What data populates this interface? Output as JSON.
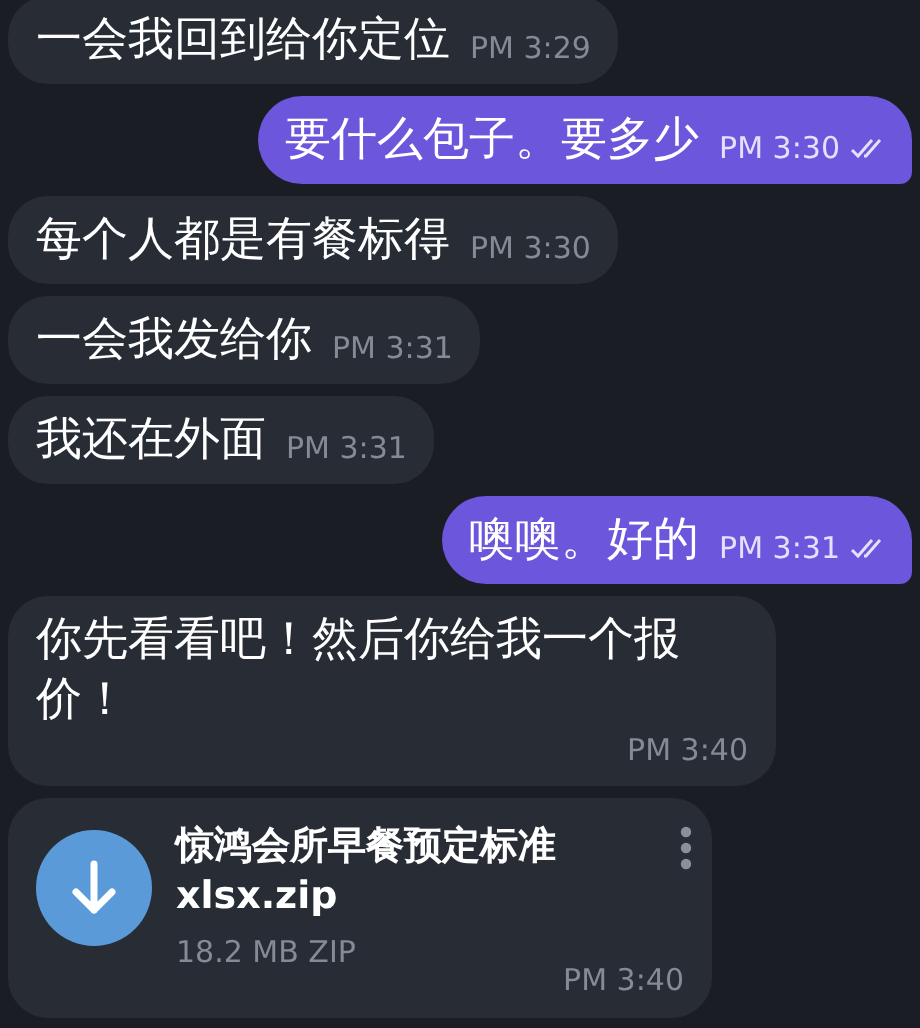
{
  "messages": [
    {
      "kind": "text",
      "outgoing": false,
      "text": "一会我回到给你定位",
      "time": "PM 3:29"
    },
    {
      "kind": "text",
      "outgoing": true,
      "text": "要什么包子。要多少",
      "time": "PM 3:30",
      "read": true
    },
    {
      "kind": "text",
      "outgoing": false,
      "text": "每个人都是有餐标得",
      "time": "PM 3:30"
    },
    {
      "kind": "text",
      "outgoing": false,
      "text": "一会我发给你",
      "time": "PM 3:31"
    },
    {
      "kind": "text",
      "outgoing": false,
      "text": "我还在外面",
      "time": "PM 3:31"
    },
    {
      "kind": "text",
      "outgoing": true,
      "text": "噢噢。好的",
      "time": "PM 3:31",
      "read": true
    },
    {
      "kind": "text",
      "outgoing": false,
      "text": "你先看看吧！然后你给我一个报价！",
      "time": "PM 3:40"
    },
    {
      "kind": "file",
      "outgoing": false,
      "name": "惊鸿会所早餐预定标准xlsx.zip",
      "size": "18.2 MB ZIP",
      "time": "PM 3:40"
    }
  ]
}
